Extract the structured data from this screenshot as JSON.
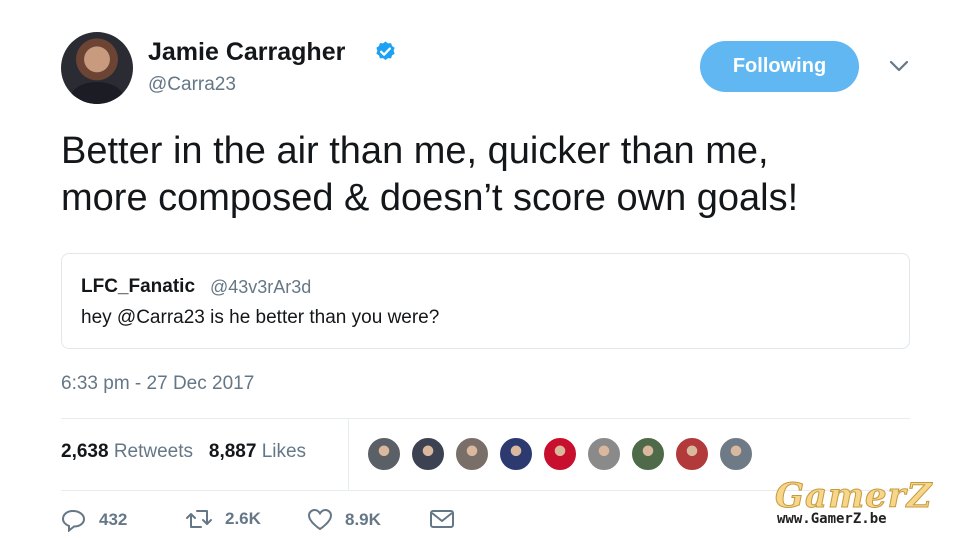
{
  "author": {
    "name": "Jamie Carragher",
    "handle": "@Carra23",
    "verified": true,
    "verified_icon": "verified-badge-icon"
  },
  "follow_button": {
    "label": "Following"
  },
  "menu_icon": "chevron-down-icon",
  "tweet": {
    "line1": "Better in the air than me, quicker than me,",
    "line2": "more composed & doesn’t score own goals!"
  },
  "quoted_tweet": {
    "name": "LFC_Fanatic",
    "handle": "@43v3rAr3d",
    "text": "hey @Carra23 is he better than you were?"
  },
  "timestamp": "6:33 pm - 27 Dec 2017",
  "stats": {
    "retweets_count": "2,638",
    "retweets_label": "Retweets",
    "likes_count": "8,887",
    "likes_label": "Likes"
  },
  "likers": [
    {
      "color": "#5b5f66"
    },
    {
      "color": "#3c4252"
    },
    {
      "color": "#7a6e68"
    },
    {
      "color": "#2c3a70"
    },
    {
      "color": "#c8102e"
    },
    {
      "color": "#8a8a8a"
    },
    {
      "color": "#4f6a48"
    },
    {
      "color": "#b23a3a"
    },
    {
      "color": "#6e7b86"
    }
  ],
  "actions": {
    "reply_count": "432",
    "retweet_count": "2.6K",
    "like_count": "8.9K"
  },
  "watermark": {
    "title": "GamerZ",
    "url": "www.GamerZ.be"
  },
  "colors": {
    "accent": "#60b7f2",
    "secondary_text": "#657786",
    "verified": "#1da1f2"
  }
}
